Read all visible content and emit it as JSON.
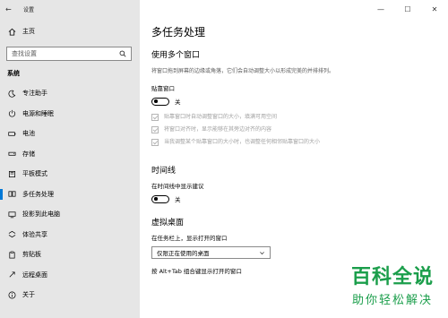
{
  "window": {
    "title": "设置",
    "controls": [
      "minimize",
      "maximize",
      "close"
    ]
  },
  "sidebar": {
    "home_label": "主页",
    "search_placeholder": "查找设置",
    "section_label": "系统",
    "items": [
      {
        "label": "专注助手",
        "icon": "moon-icon"
      },
      {
        "label": "电源和睡眠",
        "icon": "power-icon"
      },
      {
        "label": "电池",
        "icon": "battery-icon"
      },
      {
        "label": "存储",
        "icon": "storage-icon"
      },
      {
        "label": "平板模式",
        "icon": "tablet-icon"
      },
      {
        "label": "多任务处理",
        "icon": "multitask-icon",
        "selected": true
      },
      {
        "label": "投影到此电脑",
        "icon": "project-icon"
      },
      {
        "label": "体验共享",
        "icon": "share-icon"
      },
      {
        "label": "剪贴板",
        "icon": "clipboard-icon"
      },
      {
        "label": "远程桌面",
        "icon": "remote-icon"
      },
      {
        "label": "关于",
        "icon": "info-icon"
      }
    ]
  },
  "main": {
    "page_title": "多任务处理",
    "snap": {
      "heading": "使用多个窗口",
      "description": "将窗口拖到屏幕的边缘或角落，它们会自动调整大小以形成完美的并排排列。",
      "toggle_label": "贴靠窗口",
      "toggle_state": "关",
      "options": [
        "贴靠窗口时自动调整窗口的大小，填满可用空间",
        "将窗口对齐时，显示能够在其旁边对齐的内容",
        "当我调整某个贴靠窗口的大小时，也调整任何相邻贴靠窗口的大小"
      ]
    },
    "timeline": {
      "heading": "时间线",
      "toggle_label": "在时间线中显示建议",
      "toggle_state": "关"
    },
    "virtual_desktops": {
      "heading": "虚拟桌面",
      "taskbar_label": "在任务栏上，显示打开的窗口",
      "taskbar_value": "仅限正在使用的桌面",
      "alttab_label": "按 Alt+Tab 组合键显示打开的窗口"
    }
  },
  "watermark": {
    "title": "百科全说",
    "subtitle": "助你轻松解决"
  },
  "colors": {
    "sidebar_bg": "#e6e6e6",
    "accent": "#0078d7",
    "watermark": "#1b9e4b"
  }
}
